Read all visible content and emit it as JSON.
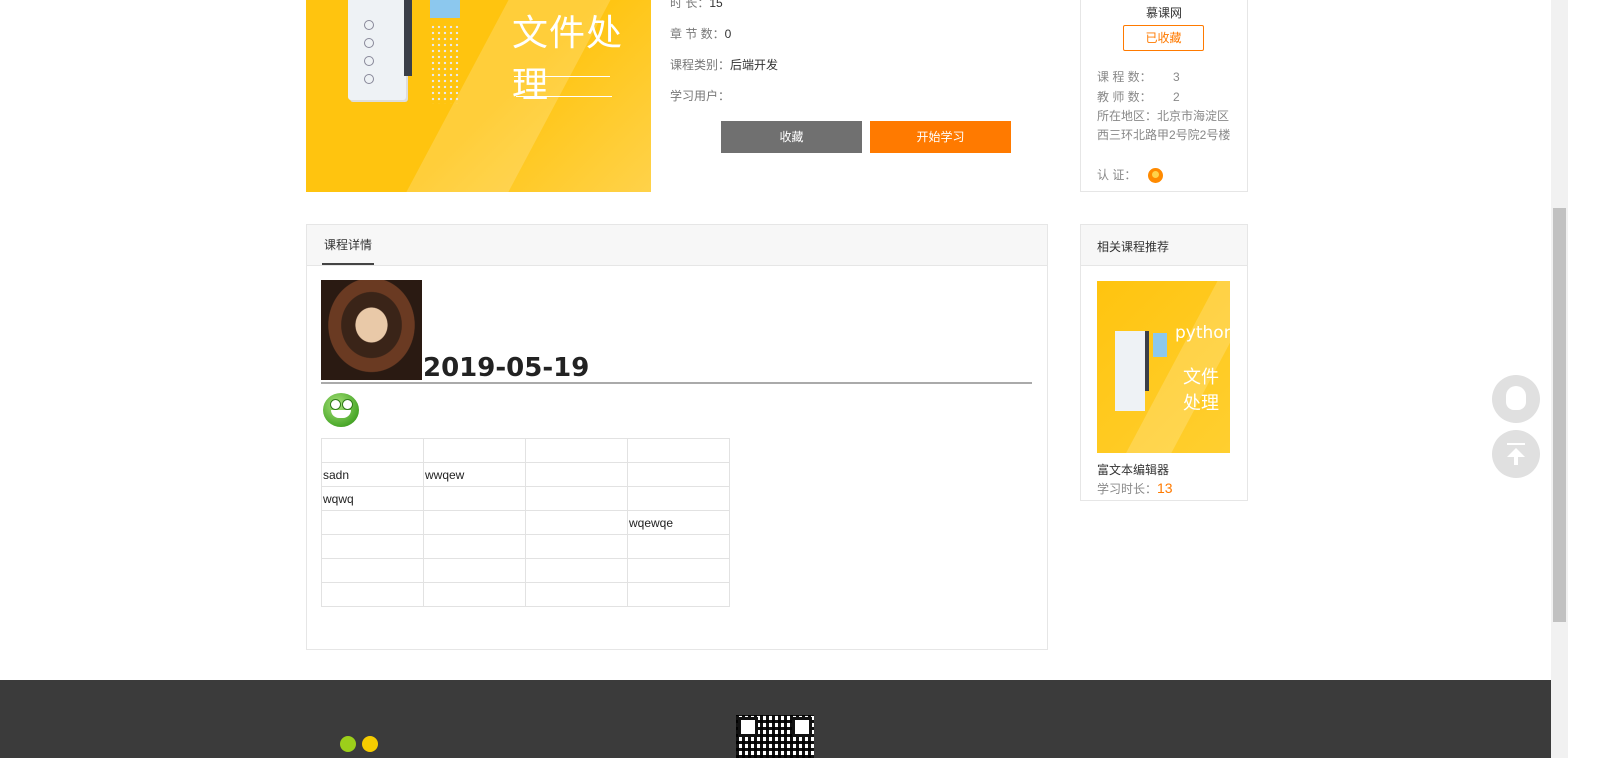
{
  "course": {
    "title_on_cover": "文件处理",
    "duration_label": "时 长：",
    "duration_value": "15",
    "chapters_label": "章 节 数：",
    "chapters_value": "0",
    "category_label": "课程类别：",
    "category_value": "后端开发",
    "learners_label": "学习用户：",
    "learners_value": "",
    "fav_button": "收藏",
    "start_button": "开始学习"
  },
  "org": {
    "name": "慕课网",
    "collected_button": "已收藏",
    "course_count_label": "课 程 数：",
    "course_count_value": "3",
    "teacher_count_label": "教 师 数：",
    "teacher_count_value": "2",
    "location_label": "所在地区：",
    "location_value": "北京市海淀区西三环北路甲2号院2号楼",
    "cert_label": "认 证："
  },
  "details": {
    "tab_label": "课程详情",
    "date_heading": "2019-05-19",
    "table": [
      [
        "",
        "",
        "",
        ""
      ],
      [
        "sadn",
        "wwqew",
        "",
        ""
      ],
      [
        "wqwq",
        "",
        "",
        ""
      ],
      [
        "",
        "",
        "",
        "wqewqe"
      ],
      [
        "",
        "",
        "",
        ""
      ],
      [
        "",
        "",
        "",
        ""
      ],
      [
        "",
        "",
        "",
        ""
      ]
    ]
  },
  "related": {
    "heading": "相关课程推荐",
    "course_name": "富文本编辑器",
    "cover_text_python": "python",
    "cover_text_title": "文件处理",
    "duration_label": "学习时长：",
    "duration_value": "13"
  },
  "colors": {
    "accent": "#ff7a00",
    "cover_yellow": "#ffc40f",
    "footer_bg": "#3b3b3b"
  },
  "icons": [
    "qq-icon",
    "back-to-top-icon",
    "certified-badge-icon",
    "smiley-emoji-icon",
    "qr-code"
  ]
}
